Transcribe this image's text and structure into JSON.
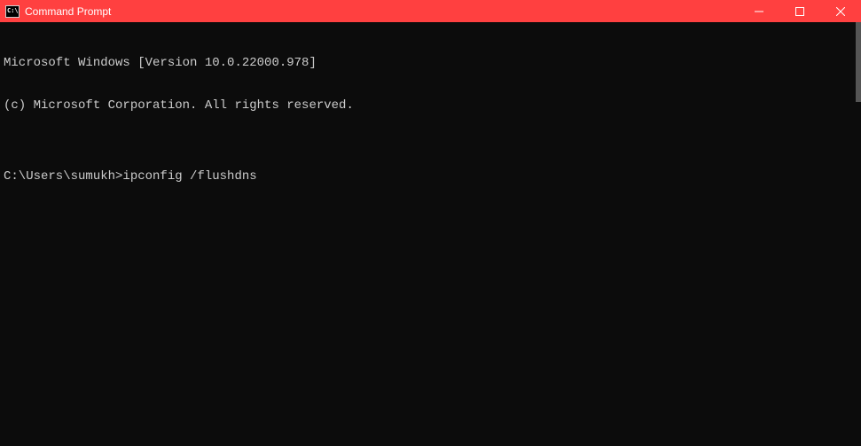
{
  "titlebar": {
    "icon_text": "C:\\",
    "title": "Command Prompt"
  },
  "terminal": {
    "line1": "Microsoft Windows [Version 10.0.22000.978]",
    "line2": "(c) Microsoft Corporation. All rights reserved.",
    "blank": "",
    "prompt": "C:\\Users\\sumukh>",
    "command": "ipconfig /flushdns"
  }
}
